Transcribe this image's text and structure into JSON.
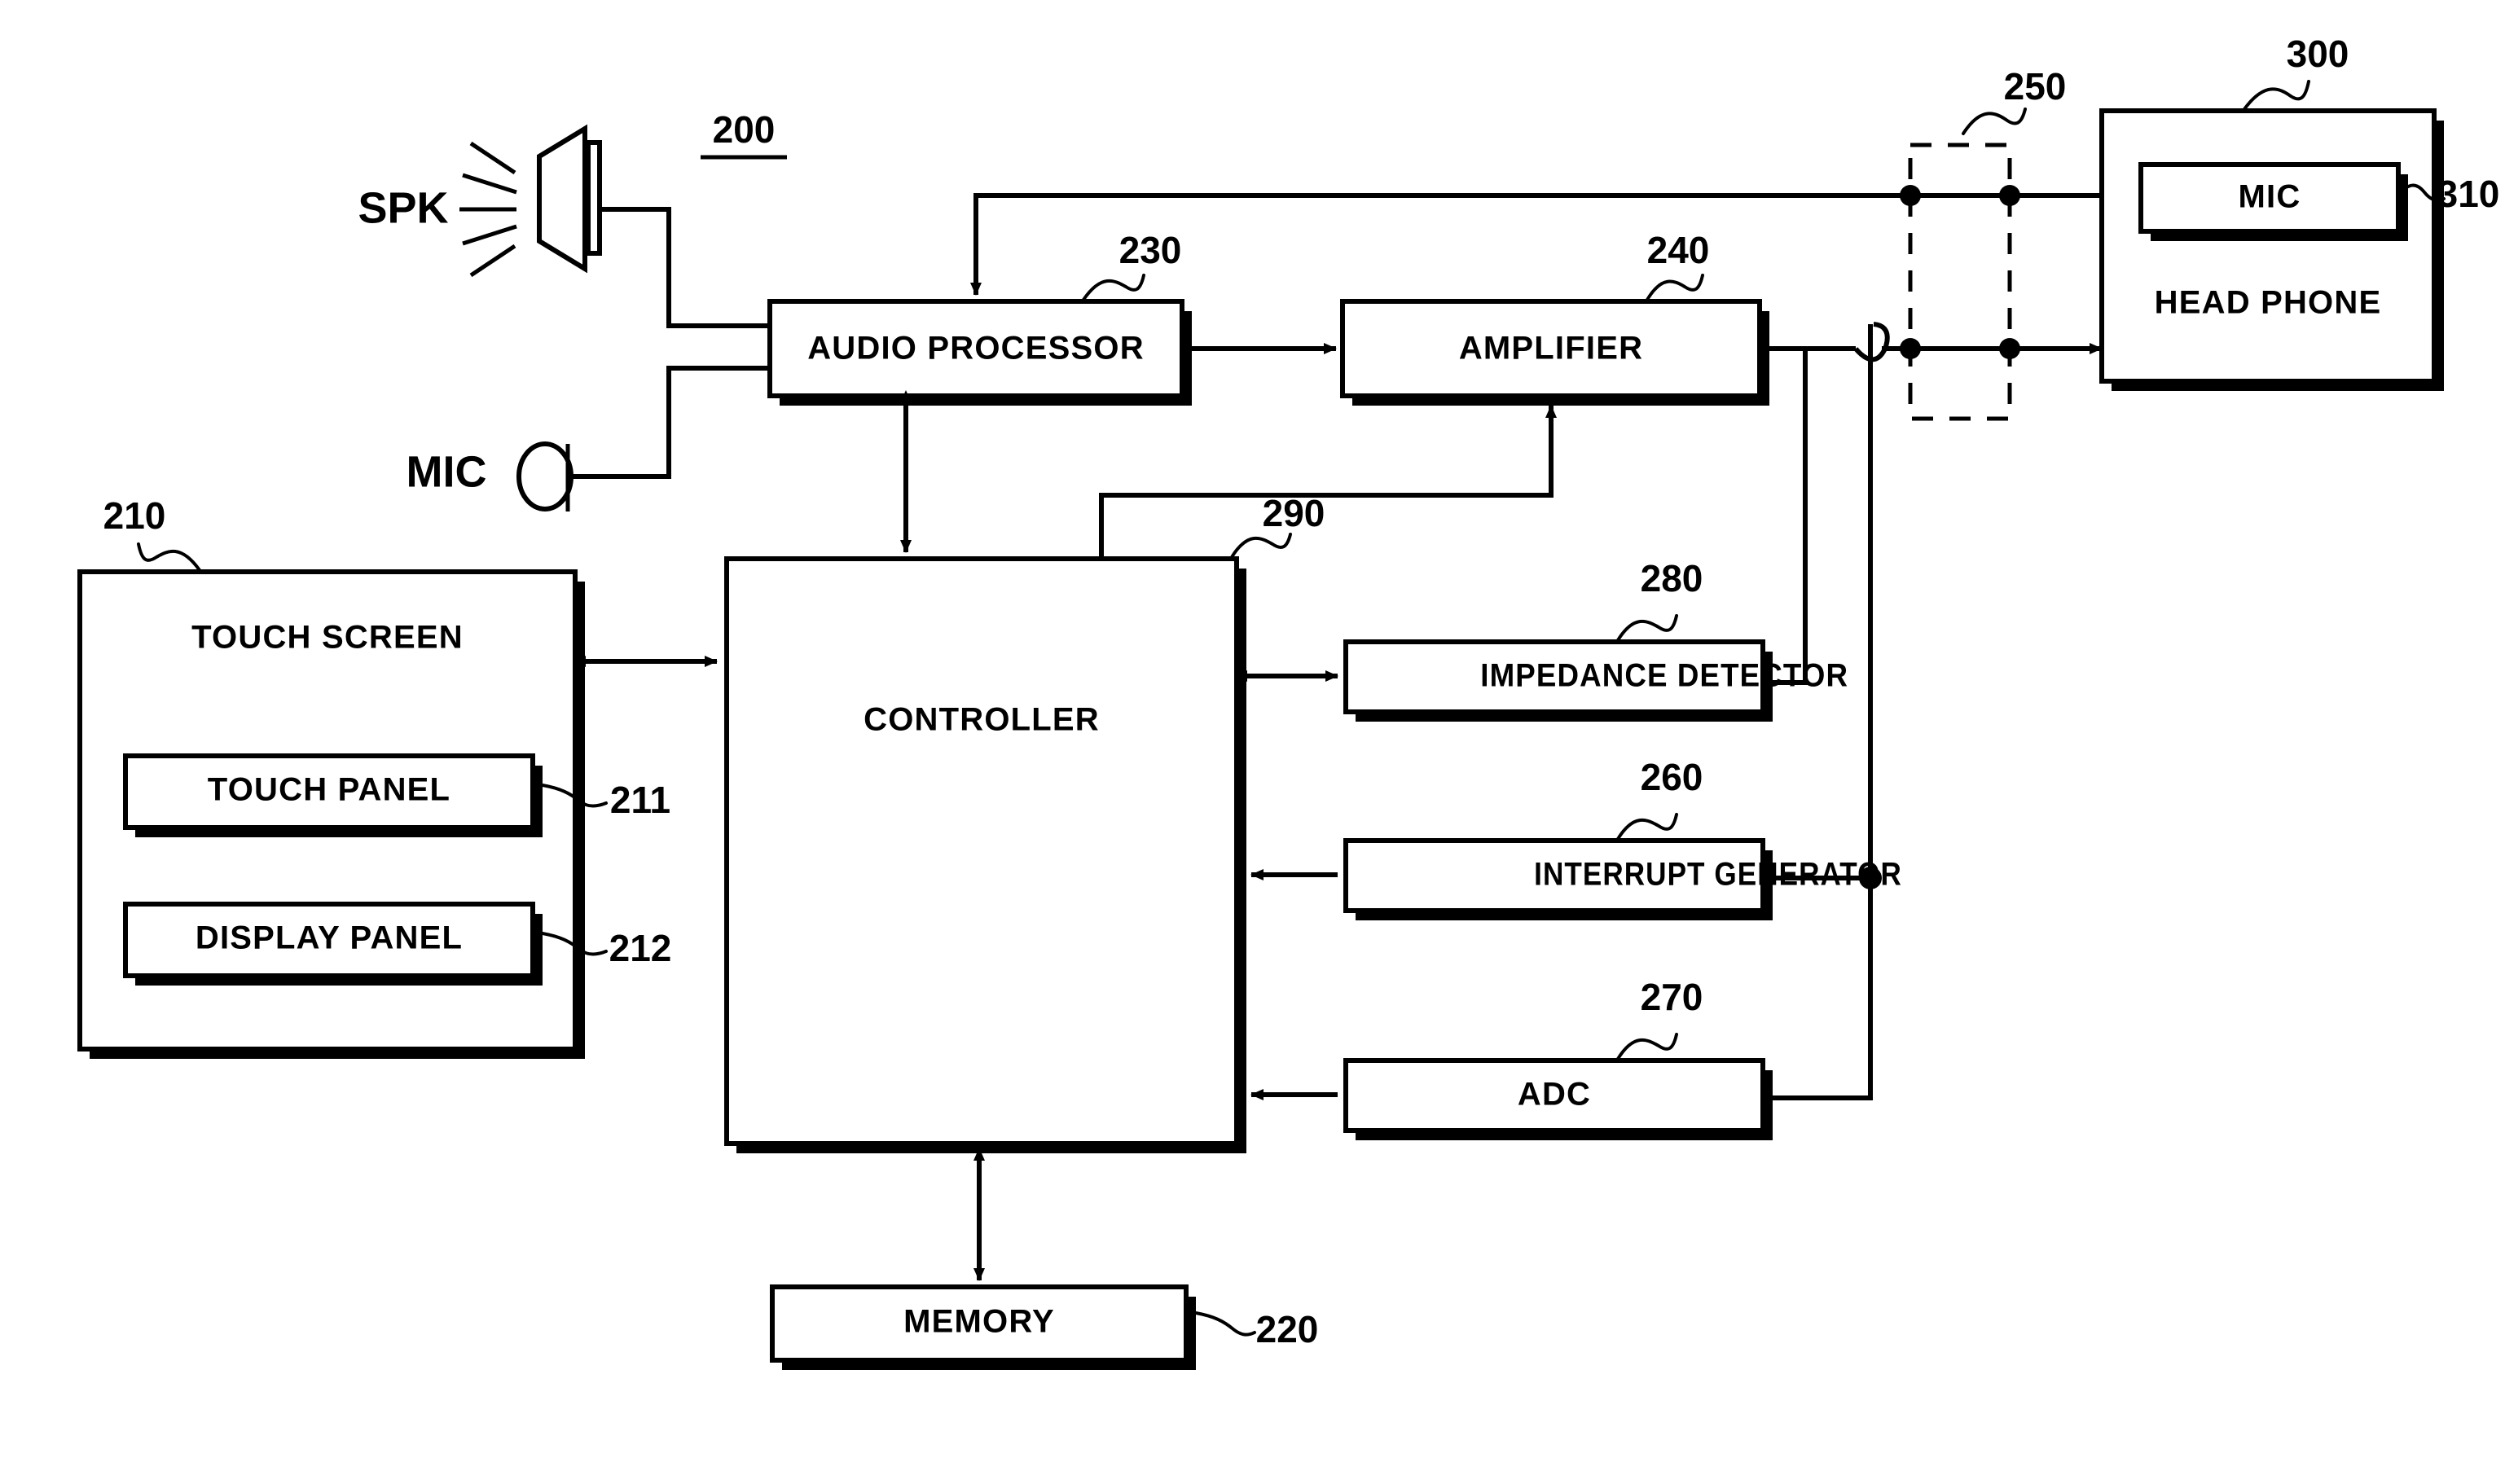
{
  "figure": {
    "type": "patent-block-diagram",
    "background_color": "#ffffff",
    "line_color": "#000000"
  },
  "system_ref": "200",
  "ports": {
    "speaker_label": "SPK",
    "microphone_label": "MIC"
  },
  "blocks": {
    "touch_screen": {
      "label": "TOUCH SCREEN",
      "ref": "210"
    },
    "touch_panel": {
      "label": "TOUCH PANEL",
      "ref": "211"
    },
    "display_panel": {
      "label": "DISPLAY PANEL",
      "ref": "212"
    },
    "memory": {
      "label": "MEMORY",
      "ref": "220"
    },
    "audio_processor": {
      "label": "AUDIO PROCESSOR",
      "ref": "230"
    },
    "amplifier": {
      "label": "AMPLIFIER",
      "ref": "240"
    },
    "jack": {
      "label": "",
      "ref": "250"
    },
    "interrupt_generator": {
      "label": "INTERRUPT GENERATOR",
      "ref": "260"
    },
    "adc": {
      "label": "ADC",
      "ref": "270"
    },
    "impedance_detector": {
      "label": "IMPEDANCE DETECTOR",
      "ref": "280"
    },
    "controller": {
      "label": "CONTROLLER",
      "ref": "290"
    },
    "head_phone": {
      "label": "HEAD PHONE",
      "ref": "300"
    },
    "head_phone_mic": {
      "label": "MIC",
      "ref": "310"
    }
  },
  "reference_numerals": [
    "200",
    "210",
    "211",
    "212",
    "220",
    "230",
    "240",
    "250",
    "260",
    "270",
    "280",
    "290",
    "300",
    "310"
  ]
}
